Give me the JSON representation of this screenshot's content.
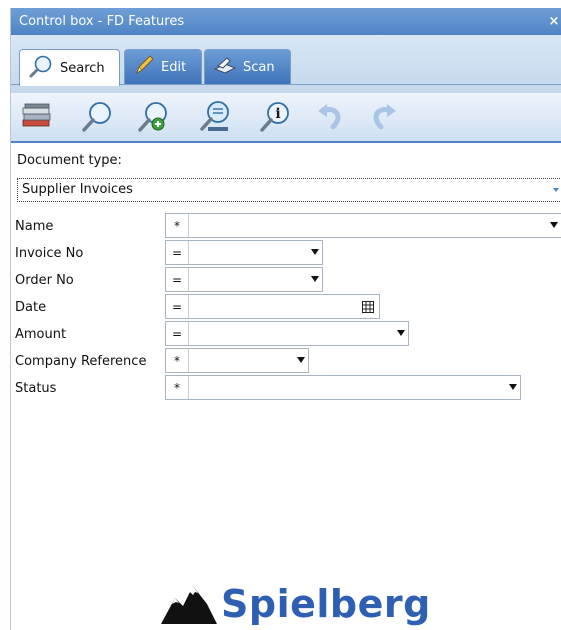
{
  "window": {
    "title": "Control box - FD Features",
    "close_label": "×"
  },
  "tabs": [
    {
      "label": "Search",
      "icon": "magnifier-icon",
      "active": true
    },
    {
      "label": "Edit",
      "icon": "pencil-icon",
      "active": false
    },
    {
      "label": "Scan",
      "icon": "scanner-icon",
      "active": false
    }
  ],
  "toolbar": {
    "buttons": [
      {
        "icon": "document-stack-icon"
      },
      {
        "icon": "search-icon"
      },
      {
        "icon": "search-add-icon"
      },
      {
        "icon": "search-document-icon"
      },
      {
        "icon": "search-info-icon"
      },
      {
        "icon": "undo-icon",
        "enabled": false
      },
      {
        "icon": "redo-icon",
        "enabled": false
      }
    ]
  },
  "doctype": {
    "label": "Document type:",
    "value": "Supplier Invoices"
  },
  "fields": [
    {
      "label": "Name",
      "operator": "*",
      "value": ""
    },
    {
      "label": "Invoice No",
      "operator": "=",
      "value": ""
    },
    {
      "label": "Order No",
      "operator": "=",
      "value": ""
    },
    {
      "label": "Date",
      "operator": "=",
      "value": ""
    },
    {
      "label": "Amount",
      "operator": "=",
      "value": ""
    },
    {
      "label": "Company Reference",
      "operator": "*",
      "value": ""
    },
    {
      "label": "Status",
      "operator": "*",
      "value": ""
    }
  ],
  "branding": {
    "logo_text": "Spielberg"
  },
  "colors": {
    "accent": "#4f83c4",
    "logo": "#2f5fb3"
  }
}
